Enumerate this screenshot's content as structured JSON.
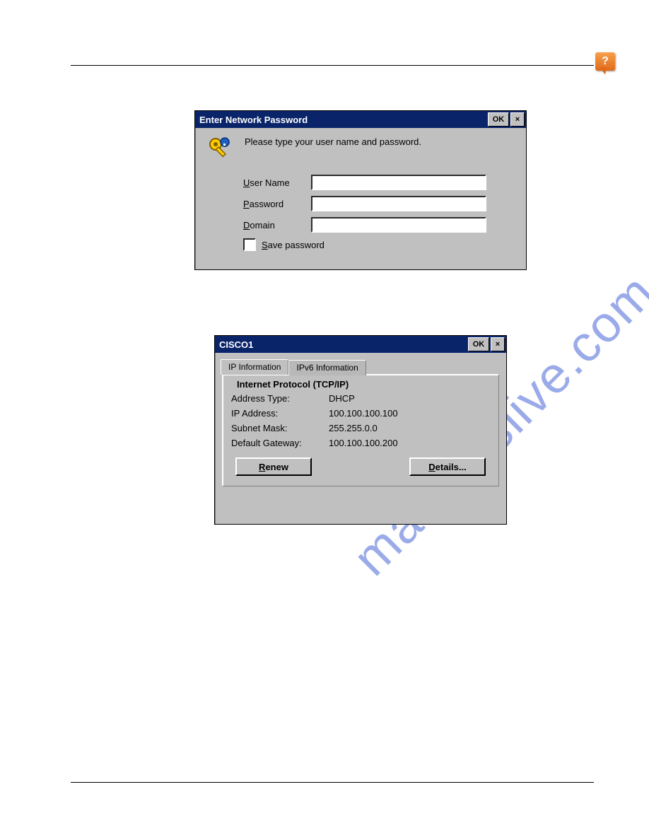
{
  "watermark_text": "manualslive.com",
  "help_badge": "?",
  "dialog1": {
    "title": "Enter Network Password",
    "ok": "OK",
    "close": "×",
    "message": "Please type your user name and password.",
    "fields": {
      "user_label_u": "U",
      "user_label_rest": "ser Name",
      "pass_label_p": "P",
      "pass_label_rest": "assword",
      "domain_label_d": "D",
      "domain_label_rest": "omain",
      "user_value": "",
      "pass_value": "",
      "domain_value": ""
    },
    "save_s": "S",
    "save_rest": "ave password"
  },
  "dialog2": {
    "title": "CISCO1",
    "ok": "OK",
    "close": "×",
    "tab1": "IP Information",
    "tab2": "IPv6 Information",
    "legend": "Internet Protocol (TCP/IP)",
    "rows": [
      {
        "k": "Address Type:",
        "v": "DHCP"
      },
      {
        "k": "IP Address:",
        "v": "100.100.100.100"
      },
      {
        "k": "Subnet Mask:",
        "v": "255.255.0.0"
      },
      {
        "k": "Default Gateway:",
        "v": "100.100.100.200"
      }
    ],
    "renew_r": "R",
    "renew_rest": "enew",
    "details_d": "D",
    "details_rest": "etails..."
  }
}
